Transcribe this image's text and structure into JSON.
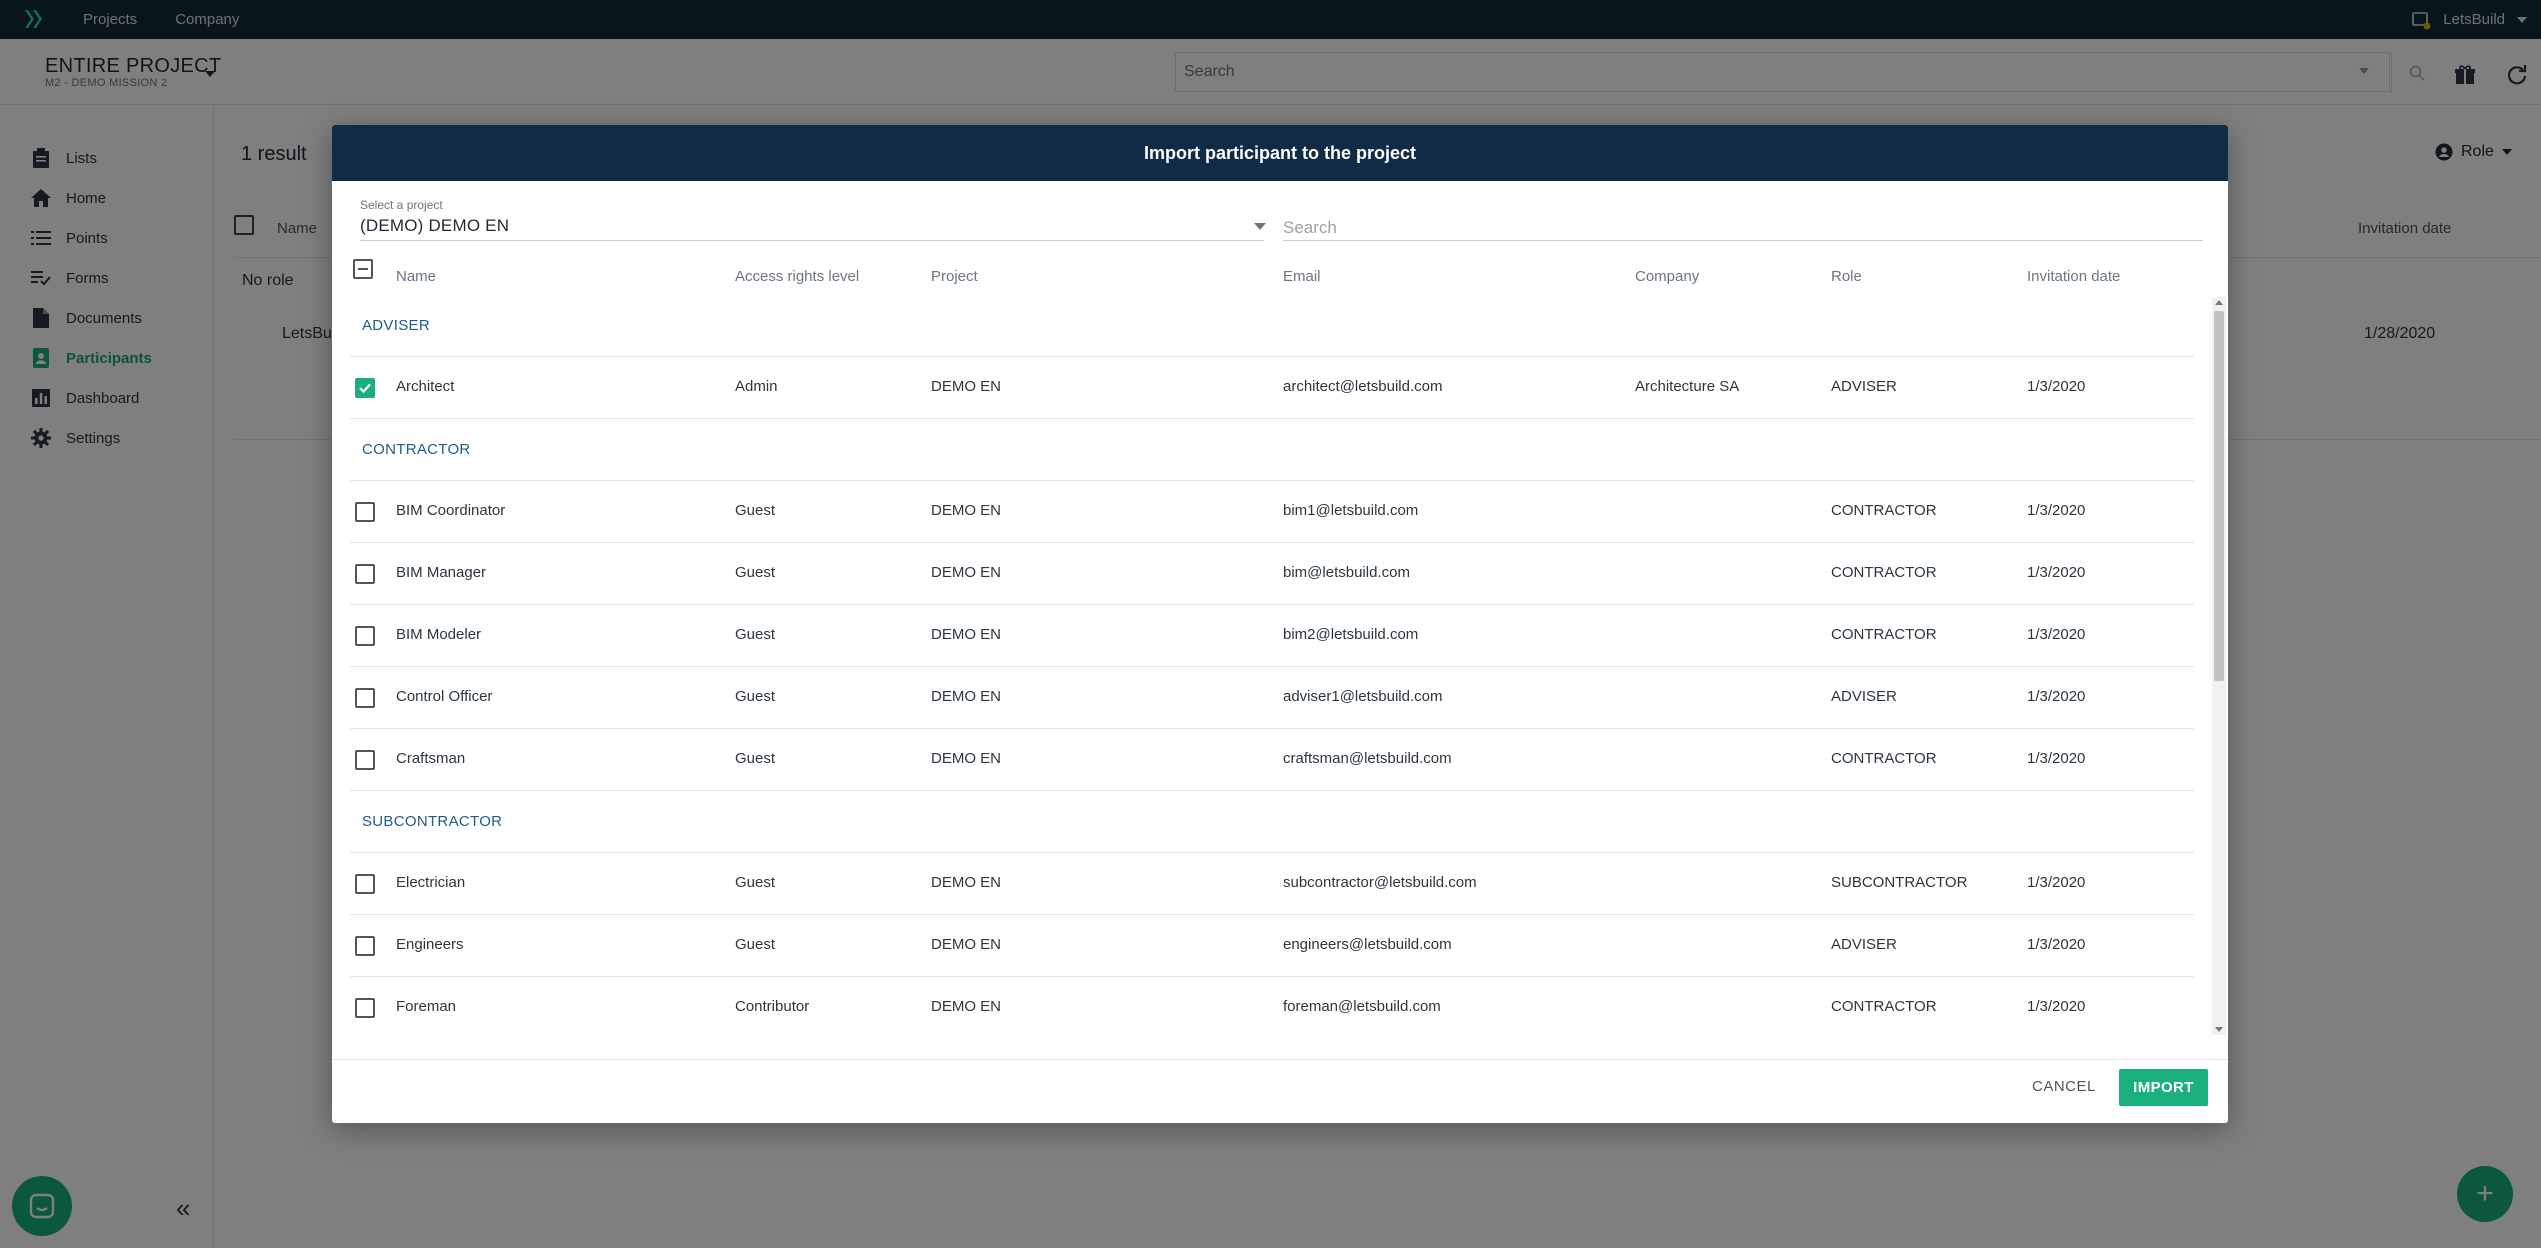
{
  "topbar": {
    "nav": [
      "Projects",
      "Company"
    ],
    "user": "LetsBuild"
  },
  "header": {
    "project_title": "ENTIRE PROJECT",
    "project_subtitle": "M2 - DEMO MISSION 2",
    "search_placeholder": "Search"
  },
  "sidebar": {
    "items": [
      {
        "label": "Lists",
        "icon": "clipboard-icon",
        "active": false
      },
      {
        "label": "Home",
        "icon": "home-icon",
        "active": false
      },
      {
        "label": "Points",
        "icon": "list-icon",
        "active": false
      },
      {
        "label": "Forms",
        "icon": "checklist-icon",
        "active": false
      },
      {
        "label": "Documents",
        "icon": "document-icon",
        "active": false
      },
      {
        "label": "Participants",
        "icon": "contact-icon",
        "active": true
      },
      {
        "label": "Dashboard",
        "icon": "bar-chart-icon",
        "active": false
      },
      {
        "label": "Settings",
        "icon": "gear-icon",
        "active": false
      }
    ]
  },
  "background": {
    "result_count": "1 result",
    "role_filter": "Role",
    "col_name": "Name",
    "col_invitation": "Invitation date",
    "no_role": "No role",
    "row_name": "LetsBuil",
    "row_date": "1/28/2020"
  },
  "modal": {
    "title": "Import participant to the project",
    "select_label": "Select a project",
    "select_value": "(DEMO) DEMO EN",
    "search_placeholder": "Search",
    "columns": [
      "Name",
      "Access rights level",
      "Project",
      "Email",
      "Company",
      "Role",
      "Invitation date"
    ],
    "groups": [
      {
        "name": "ADVISER",
        "rows": [
          {
            "name": "Architect",
            "access": "Admin",
            "project": "DEMO EN",
            "email": "architect@letsbuild.com",
            "company": "Architecture SA",
            "role": "ADVISER",
            "date": "1/3/2020",
            "checked": true
          }
        ]
      },
      {
        "name": "CONTRACTOR",
        "rows": [
          {
            "name": "BIM Coordinator",
            "access": "Guest",
            "project": "DEMO EN",
            "email": "bim1@letsbuild.com",
            "company": "",
            "role": "CONTRACTOR",
            "date": "1/3/2020",
            "checked": false
          },
          {
            "name": "BIM Manager",
            "access": "Guest",
            "project": "DEMO EN",
            "email": "bim@letsbuild.com",
            "company": "",
            "role": "CONTRACTOR",
            "date": "1/3/2020",
            "checked": false
          },
          {
            "name": "BIM Modeler",
            "access": "Guest",
            "project": "DEMO EN",
            "email": "bim2@letsbuild.com",
            "company": "",
            "role": "CONTRACTOR",
            "date": "1/3/2020",
            "checked": false
          },
          {
            "name": "Control Officer",
            "access": "Guest",
            "project": "DEMO EN",
            "email": "adviser1@letsbuild.com",
            "company": "",
            "role": "ADVISER",
            "date": "1/3/2020",
            "checked": false
          },
          {
            "name": "Craftsman",
            "access": "Guest",
            "project": "DEMO EN",
            "email": "craftsman@letsbuild.com",
            "company": "",
            "role": "CONTRACTOR",
            "date": "1/3/2020",
            "checked": false
          }
        ]
      },
      {
        "name": "SUBCONTRACTOR",
        "rows": [
          {
            "name": "Electrician",
            "access": "Guest",
            "project": "DEMO EN",
            "email": "subcontractor@letsbuild.com",
            "company": "",
            "role": "SUBCONTRACTOR",
            "date": "1/3/2020",
            "checked": false
          },
          {
            "name": "Engineers",
            "access": "Guest",
            "project": "DEMO EN",
            "email": "engineers@letsbuild.com",
            "company": "",
            "role": "ADVISER",
            "date": "1/3/2020",
            "checked": false
          },
          {
            "name": "Foreman",
            "access": "Contributor",
            "project": "DEMO EN",
            "email": "foreman@letsbuild.com",
            "company": "",
            "role": "CONTRACTOR",
            "date": "1/3/2020",
            "checked": false
          }
        ]
      }
    ],
    "cancel_label": "CANCEL",
    "import_label": "IMPORT"
  },
  "colors": {
    "topbar": "#122a3b",
    "modal_header": "#0f2b45",
    "accent_green": "#19b07e",
    "group_label": "#1f5d86"
  }
}
